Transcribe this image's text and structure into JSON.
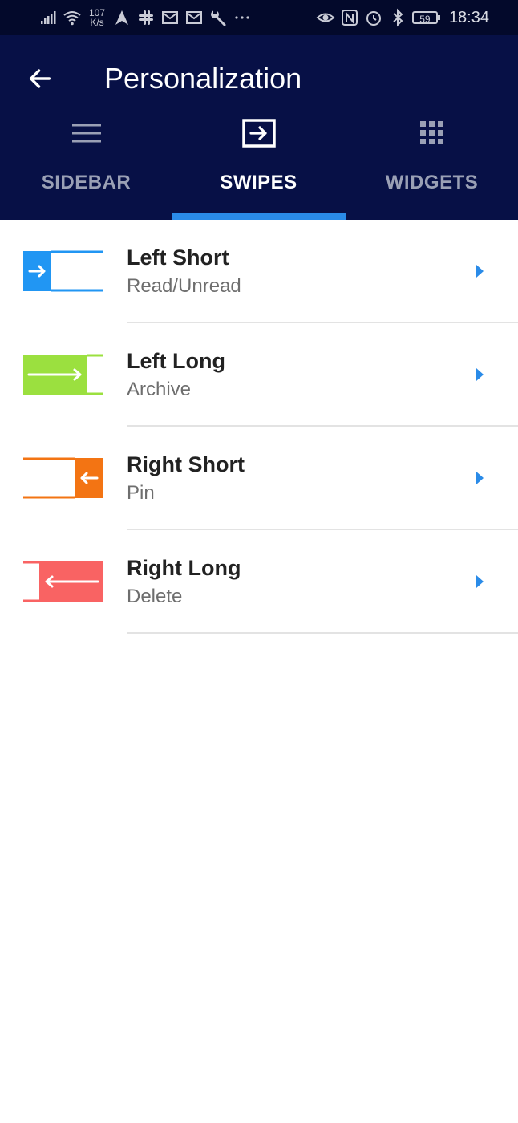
{
  "status_bar": {
    "net_speed_value": "107",
    "net_speed_unit": "K/s",
    "battery": "59",
    "time": "18:34",
    "icons_left": [
      "signal-icon",
      "wifi-icon",
      "navigation-icon",
      "slack-icon",
      "gmail-icon",
      "gmail-icon",
      "wrench-icon",
      "more-icon"
    ],
    "icons_right": [
      "eye-icon",
      "nfc-icon",
      "alarm-icon",
      "bluetooth-icon",
      "battery-icon"
    ]
  },
  "header": {
    "title": "Personalization",
    "back_icon": "arrow-back-icon",
    "background": "#071046"
  },
  "tabs": [
    {
      "label": "SIDEBAR",
      "icon": "menu-lines-icon",
      "active": false
    },
    {
      "label": "SWIPES",
      "icon": "swipe-box-arrow-icon",
      "active": true
    },
    {
      "label": "WIDGETS",
      "icon": "grid-icon",
      "active": false
    }
  ],
  "accent": "#2a8be8",
  "swipes": [
    {
      "title": "Left Short",
      "action": "Read/Unread",
      "color": "#2196f3",
      "icon": "swipe-left-short-icon"
    },
    {
      "title": "Left Long",
      "action": "Archive",
      "color": "#9be03f",
      "icon": "swipe-left-long-icon"
    },
    {
      "title": "Right Short",
      "action": "Pin",
      "color": "#f37413",
      "icon": "swipe-right-short-icon"
    },
    {
      "title": "Right Long",
      "action": "Delete",
      "color": "#f96363",
      "icon": "swipe-right-long-icon"
    }
  ]
}
